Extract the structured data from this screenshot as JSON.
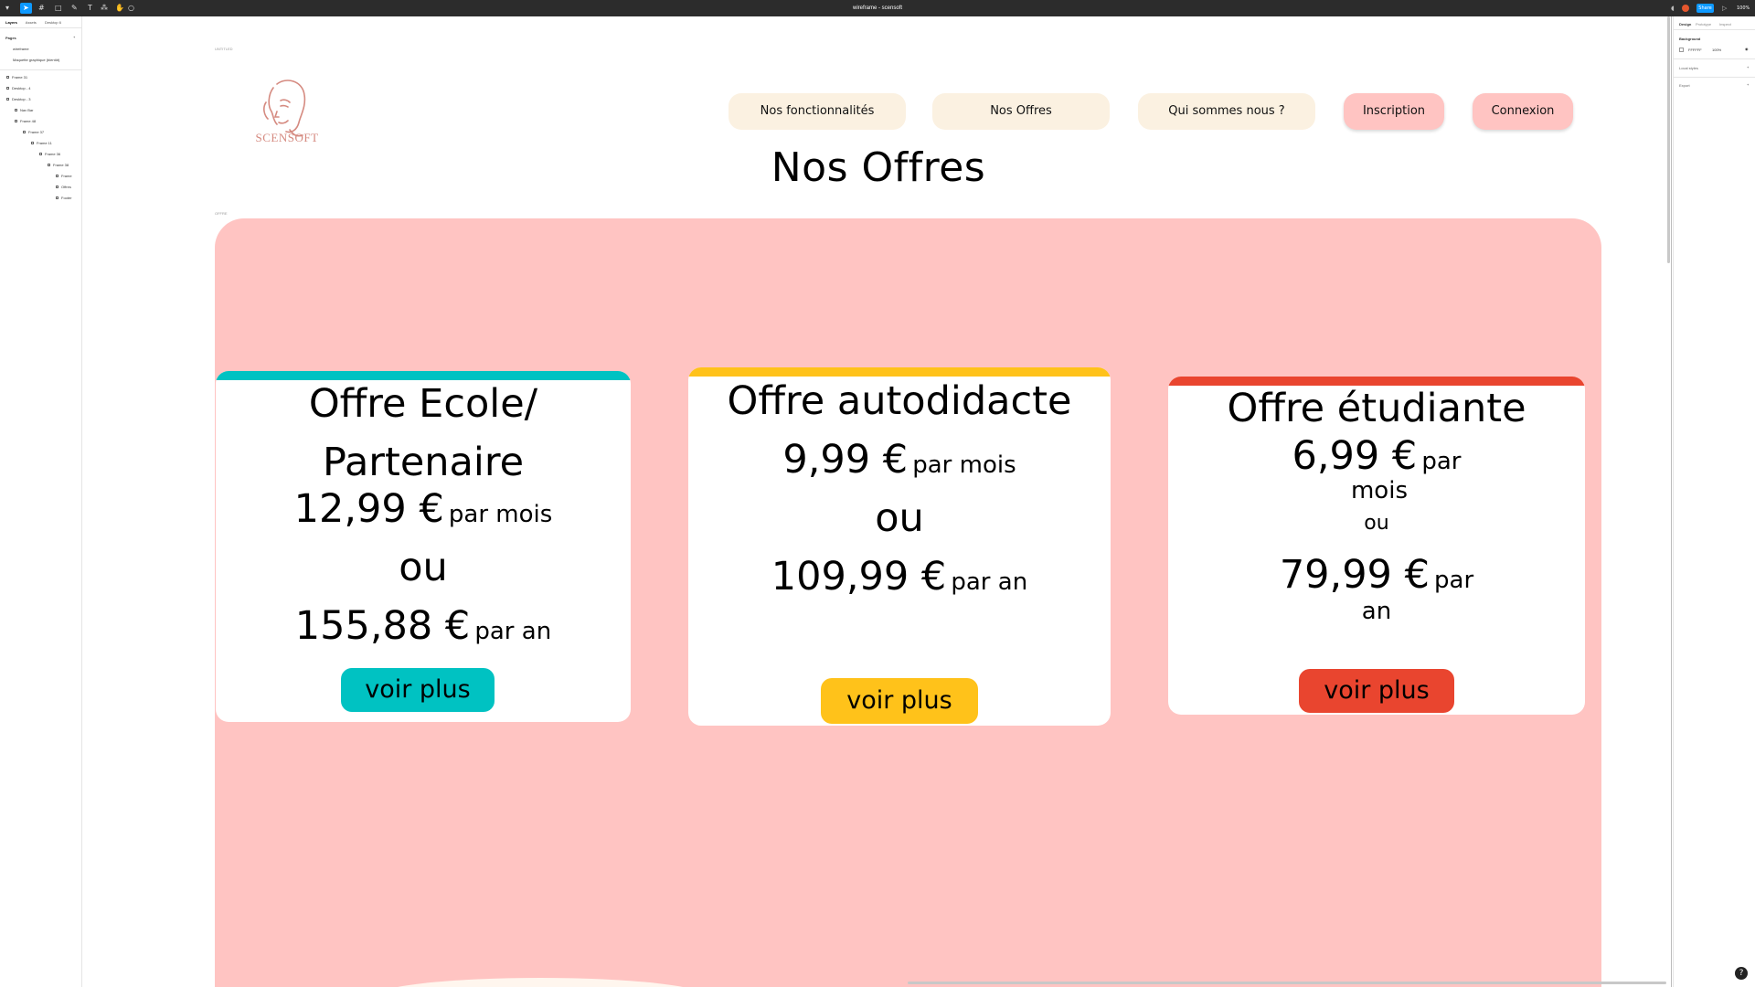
{
  "app": {
    "file_title": "wireframe - scensoft",
    "share_label": "Share",
    "zoom": "100%",
    "help": "?"
  },
  "layers_panel": {
    "tabs": [
      "Layers",
      "Assets",
      "Desktop 6"
    ],
    "pages_label": "Pages",
    "pages": [
      "wireframe",
      "Maquette graphique (bientôt)"
    ],
    "layers": [
      "Frame 31",
      "Desktop - 4",
      "Desktop - 3",
      "Nav Bar",
      "Frame 48",
      "Frame 37",
      "Frame 11",
      "Frame 36",
      "Frame 38",
      "Frame",
      "Offres",
      "Footer"
    ]
  },
  "design_panel": {
    "tabs": [
      "Design",
      "Prototype",
      "Inspect"
    ],
    "background_label": "Background",
    "background_hex": "FFFFFF",
    "background_opacity": "100%",
    "local_styles": "Local styles",
    "export": "Export"
  },
  "frame_labels": {
    "top": "UNTITLED",
    "section": "OFFRE"
  },
  "site": {
    "logo_text": "SCENSOFT",
    "nav": [
      "Nos fonctionnalités",
      "Nos Offres",
      "Qui sommes nous ?",
      "Inscription",
      "Connexion"
    ],
    "page_title": "Nos Offres"
  },
  "offers": [
    {
      "title_line1": "Offre Ecole/",
      "title_line2": "Partenaire",
      "monthly_price": "12,99 €",
      "monthly_unit": "par mois",
      "or": "ou",
      "yearly_price": "155,88 €",
      "yearly_unit": "par an",
      "button": "voir plus",
      "accent": "#00c2c2"
    },
    {
      "title_line1": "Offre autodidacte",
      "monthly_price": "9,99 €",
      "monthly_unit": "par mois",
      "or": "ou",
      "yearly_price": "109,99 €",
      "yearly_unit": "par an",
      "button": "voir plus",
      "accent": "#ffc21a"
    },
    {
      "title_line1": "Offre étudiante",
      "monthly_price": "6,99 €",
      "monthly_unit_line1": "par",
      "monthly_unit_line2": "mois",
      "or": "ou",
      "yearly_price": "79,99 €",
      "yearly_unit_line1": "par",
      "yearly_unit_line2": "an",
      "button": "voir plus",
      "accent": "#e9452f"
    }
  ],
  "colors": {
    "section_bg": "#ffc4c2",
    "nav_beige": "#fbf1e1",
    "nav_pink": "#ffc4c2",
    "logo": "#d58a80"
  }
}
